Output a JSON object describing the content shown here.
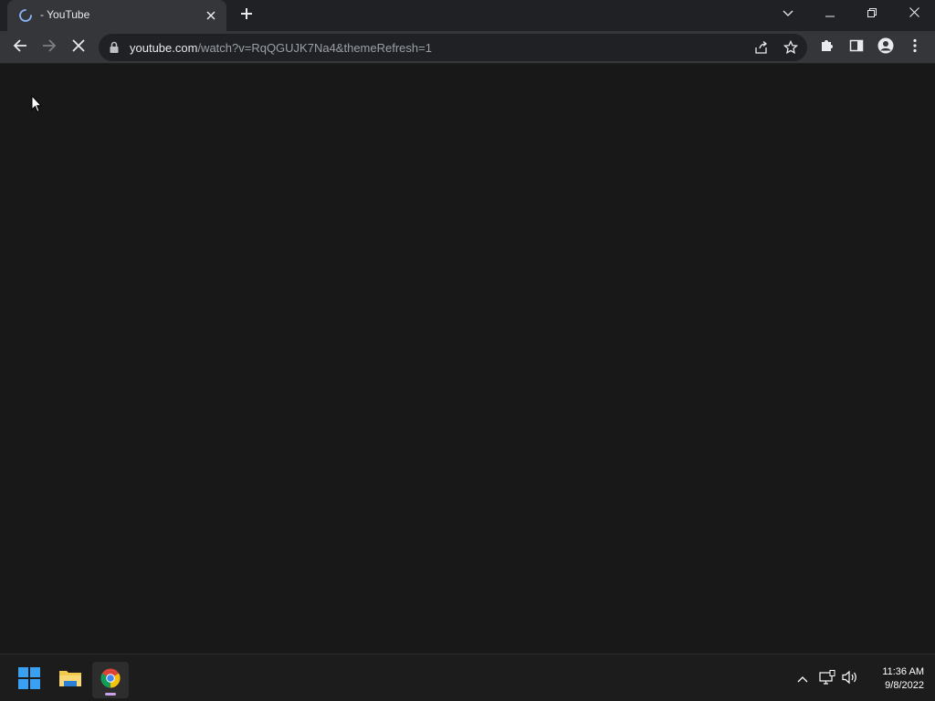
{
  "browser": {
    "tab": {
      "title": "- YouTube"
    },
    "address": {
      "host": "youtube.com",
      "path": "/watch?v=RqQGUJK7Na4&themeRefresh=1"
    },
    "icons": {
      "spinner": "loading-spinner-icon",
      "close": "close-icon",
      "new_tab": "plus-icon",
      "back": "arrow-left-icon",
      "forward": "arrow-right-icon",
      "stop": "stop-icon",
      "lock": "lock-icon",
      "share": "share-icon",
      "bookmark": "star-icon",
      "extensions": "puzzle-icon",
      "side_panel": "side-panel-icon",
      "profile": "profile-icon",
      "menu": "kebab-menu-icon",
      "tab_search": "chevron-down-icon",
      "minimize": "minimize-icon",
      "restore": "restore-icon",
      "window_close": "window-close-icon"
    }
  },
  "taskbar": {
    "apps": [
      {
        "name": "Start",
        "icon": "windows-start-icon"
      },
      {
        "name": "File Explorer",
        "icon": "folder-icon"
      },
      {
        "name": "Google Chrome",
        "icon": "chrome-icon"
      }
    ],
    "tray": {
      "icons": [
        "chevron-up-icon",
        "network-icon",
        "volume-icon"
      ],
      "time": "11:36 AM",
      "date": "9/8/2022"
    }
  },
  "colors": {
    "page_bg": "#181818",
    "tabstrip_bg": "#202124",
    "toolbar_bg": "#35363a",
    "omnibox_bg": "#202124",
    "taskbar_bg": "#1c1c1c",
    "accent_indicator": "#c8a2e6"
  }
}
